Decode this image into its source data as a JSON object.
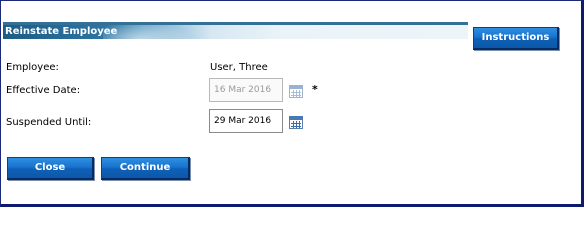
{
  "header": {
    "title": "Reinstate Employee"
  },
  "toolbar": {
    "instructions_label": "Instructions"
  },
  "form": {
    "employee_label": "Employee:",
    "employee_value": "User, Three",
    "effective_date_label": "Effective Date:",
    "effective_date_value": "16 Mar 2016",
    "required_marker": "*",
    "suspended_until_label": "Suspended Until:",
    "suspended_until_value": "29 Mar 2016"
  },
  "actions": {
    "close_label": "Close",
    "continue_label": "Continue"
  },
  "colors": {
    "button_blue": "#1873cf",
    "header_blue": "#1d5c86",
    "frame_border": "#1b2a78"
  },
  "icons": [
    "calendar-icon"
  ]
}
